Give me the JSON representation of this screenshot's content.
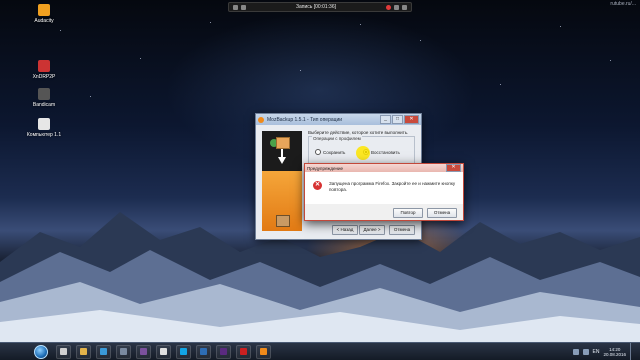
{
  "recorder": {
    "title": "Запись [00:01:36]"
  },
  "watermark": "rutube.ru/...",
  "desktop_icons": [
    {
      "label": "Audacity",
      "icon": "audacity-icon",
      "color": "#f0a020"
    },
    {
      "label": "XnDRP2P",
      "icon": "app-icon",
      "color": "#cc3333"
    },
    {
      "label": "Bandicam",
      "icon": "bandicam-icon",
      "color": "#555555"
    },
    {
      "label": "Компьютер 1.1",
      "icon": "computer-icon",
      "color": "#e6e6e6"
    }
  ],
  "main_window": {
    "title": "MozBackup 1.5.1 - Тип операции",
    "prompt": "Выберите действие, которое хотите выполнить.",
    "group_label": "Операции с профилем",
    "radio_save": "Сохранить",
    "radio_restore": "Восстановить",
    "selected": "restore",
    "btn_back": "< Назад",
    "btn_next": "Далее >",
    "btn_cancel": "Отмена"
  },
  "dialog": {
    "title": "Предупреждение",
    "message": "Запущена программа Firefox. Закройте ее и нажмите кнопку повтора.",
    "btn_retry": "Повтор",
    "btn_cancel": "Отмена"
  },
  "taskbar": {
    "items": [
      {
        "icon": "file-icon",
        "color": "#d0d0d0"
      },
      {
        "icon": "folder-icon",
        "color": "#e3b34a"
      },
      {
        "icon": "media-icon",
        "color": "#3a9ad9"
      },
      {
        "icon": "library-icon",
        "color": "#7a8aa0"
      },
      {
        "icon": "viber-icon",
        "color": "#7b519d"
      },
      {
        "icon": "audio-icon",
        "color": "#e0e0e0"
      },
      {
        "icon": "skype-icon",
        "color": "#12a5e5"
      },
      {
        "icon": "photoshop-icon",
        "color": "#2d6db5"
      },
      {
        "icon": "premiere-icon",
        "color": "#5a2a80"
      },
      {
        "icon": "record-icon",
        "color": "#cc2020"
      },
      {
        "icon": "mozbackup-icon",
        "color": "#f08a1a"
      }
    ],
    "language": "EN",
    "time": "14:20",
    "date": "20.08.2016"
  }
}
